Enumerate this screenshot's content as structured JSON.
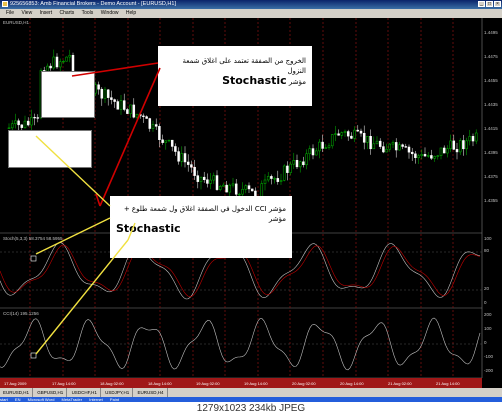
{
  "window": {
    "title": "925656853: Amb Financial Brokers - Demo Account - [EURUSD,H1]"
  },
  "menu": {
    "items": [
      "File",
      "View",
      "Insert",
      "Charts",
      "Tools",
      "Window",
      "Help"
    ]
  },
  "chart": {
    "symbol_label": "EURUSD,H1",
    "stoch_label": "Stoch(5,3,3) 58.3754 58.5955",
    "cci_label": "CCI(14) 195.1256",
    "price_ticks": [
      "1.4495",
      "1.4475",
      "1.4455",
      "1.4435",
      "1.4415",
      "1.4395",
      "1.4375",
      "1.4355"
    ],
    "stoch_ticks": [
      "100",
      "80",
      "20",
      "0"
    ],
    "cci_ticks": [
      "200",
      "100",
      "0",
      "-100",
      "-200"
    ],
    "time_ticks": [
      "17 Aug 2009",
      "17 Aug 14:00",
      "18 Aug 02:00",
      "18 Aug 14:00",
      "19 Aug 02:00",
      "19 Aug 14:00",
      "20 Aug 02:00",
      "20 Aug 14:00",
      "21 Aug 02:00",
      "21 Aug 14:00"
    ],
    "colors": {
      "background": "#000000",
      "bull_candle": "#00c000",
      "bear_candle": "#ffffff",
      "stoch_main": "#c0c0c0",
      "stoch_signal": "#c00000",
      "cci": "#c0c0c0",
      "arrow_red": "#d00000",
      "arrow_yellow": "#f0e040"
    }
  },
  "annotations": {
    "note1_arabic": "الخروج من الصفقة تعتمد على اغلاق شمعة النزول",
    "note1_arabic2": "مؤشر",
    "note1_big": "Stochastic",
    "note2_arabic": "مؤشر CCI الدخول في الصفقة اغلاق ول شمعة طلوع + مؤشر",
    "note2_big": "Stochastic"
  },
  "tabs": [
    "EURUSD,H1",
    "GBPUSD,H1",
    "USDCHF,H1",
    "USDJPY,H1",
    "EURUSD,H4"
  ],
  "taskbar": {
    "items": [
      "start",
      "EN",
      "Microsoft Word",
      "MetaTrader",
      "Internet",
      "Paint"
    ]
  },
  "caption": {
    "text": "1279x1023  234kb  JPEG"
  }
}
